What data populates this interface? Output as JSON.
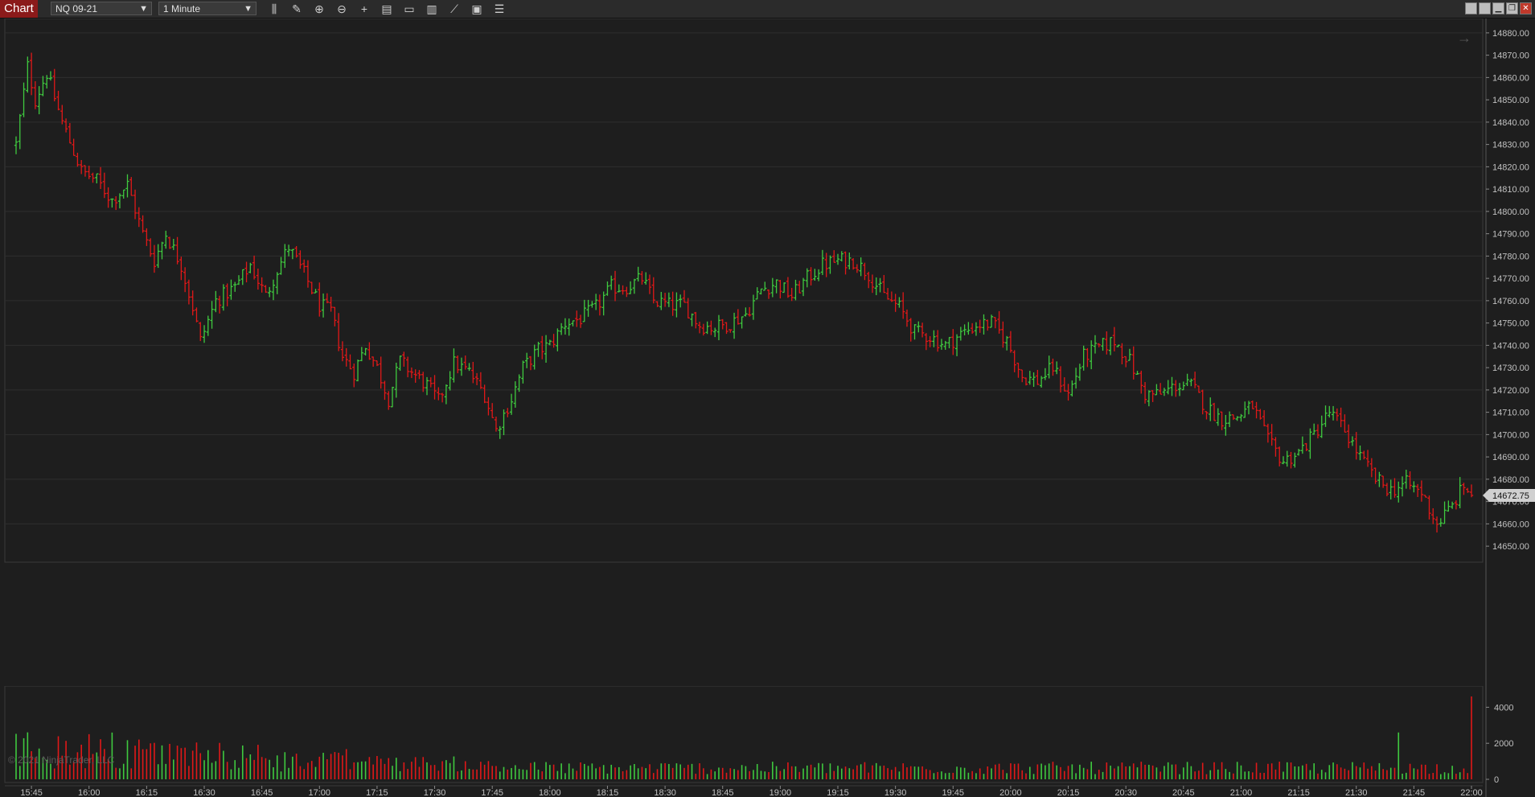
{
  "toolbar": {
    "tab_label": "Chart",
    "instrument": "NQ 09-21",
    "interval": "1 Minute",
    "tools": [
      {
        "name": "bar-type-icon",
        "glyph": "⫼"
      },
      {
        "name": "drawing-pencil-icon",
        "glyph": "✎"
      },
      {
        "name": "zoom-in-icon",
        "glyph": "⊕"
      },
      {
        "name": "zoom-out-icon",
        "glyph": "⊖"
      },
      {
        "name": "crosshair-icon",
        "glyph": "+"
      },
      {
        "name": "data-series-icon",
        "glyph": "▤"
      },
      {
        "name": "templates-icon",
        "glyph": "▭"
      },
      {
        "name": "indicators-icon",
        "glyph": "▥"
      },
      {
        "name": "strategies-icon",
        "glyph": "⟋"
      },
      {
        "name": "chart-trader-icon",
        "glyph": "▣"
      },
      {
        "name": "properties-list-icon",
        "glyph": "☰"
      }
    ],
    "window_buttons": [
      {
        "name": "window-tile-icon",
        "glyph": ""
      },
      {
        "name": "window-tile2-icon",
        "glyph": ""
      },
      {
        "name": "minimize-icon",
        "glyph": "▁"
      },
      {
        "name": "restore-icon",
        "glyph": "❐"
      },
      {
        "name": "close-icon",
        "glyph": "✕"
      }
    ]
  },
  "colors": {
    "background": "#1e1e1e",
    "grid": "#2e2e2e",
    "up": "#3fc93f",
    "down": "#e01818",
    "axis_text": "#c0c0c0",
    "price_marker_bg": "#d0d0d0"
  },
  "price_axis": {
    "min": 14645,
    "max": 14885,
    "labels": [
      "14880.00",
      "14870.00",
      "14860.00",
      "14850.00",
      "14840.00",
      "14830.00",
      "14820.00",
      "14810.00",
      "14800.00",
      "14790.00",
      "14780.00",
      "14770.00",
      "14760.00",
      "14750.00",
      "14740.00",
      "14730.00",
      "14720.00",
      "14710.00",
      "14700.00",
      "14690.00",
      "14680.00",
      "14670.00",
      "14660.00",
      "14650.00"
    ],
    "current_price": "14672.75"
  },
  "volume_axis": {
    "labels": [
      "4000",
      "2000",
      "0"
    ],
    "max": 5000
  },
  "time_axis": {
    "labels": [
      "15:45",
      "16:00",
      "16:15",
      "16:30",
      "16:45",
      "17:00",
      "17:15",
      "17:30",
      "17:45",
      "18:00",
      "18:15",
      "18:30",
      "18:45",
      "19:00",
      "19:15",
      "19:30",
      "19:45",
      "20:00",
      "20:15",
      "20:30",
      "20:45",
      "21:00",
      "21:15",
      "21:30",
      "21:45",
      "22:00"
    ]
  },
  "copyright": "© 2021 NinjaTrader, LLC",
  "chart_data": {
    "type": "ohlc",
    "bar_minutes": 1,
    "start_time": "15:41",
    "end_time": "22:00",
    "anchors": [
      [
        "15:41",
        14830
      ],
      [
        "15:44",
        14865
      ],
      [
        "15:46",
        14850
      ],
      [
        "15:49",
        14862
      ],
      [
        "15:53",
        14840
      ],
      [
        "15:58",
        14818
      ],
      [
        "16:02",
        14814
      ],
      [
        "16:06",
        14805
      ],
      [
        "16:10",
        14812
      ],
      [
        "16:14",
        14790
      ],
      [
        "16:17",
        14778
      ],
      [
        "16:20",
        14790
      ],
      [
        "16:24",
        14776
      ],
      [
        "16:27",
        14757
      ],
      [
        "16:29",
        14742
      ],
      [
        "16:33",
        14760
      ],
      [
        "16:38",
        14766
      ],
      [
        "16:42",
        14776
      ],
      [
        "16:46",
        14762
      ],
      [
        "16:49",
        14774
      ],
      [
        "16:52",
        14784
      ],
      [
        "16:56",
        14772
      ],
      [
        "17:00",
        14758
      ],
      [
        "17:03",
        14755
      ],
      [
        "17:06",
        14735
      ],
      [
        "17:09",
        14728
      ],
      [
        "17:12",
        14740
      ],
      [
        "17:15",
        14730
      ],
      [
        "17:18",
        14716
      ],
      [
        "17:21",
        14733
      ],
      [
        "17:24",
        14728
      ],
      [
        "17:28",
        14722
      ],
      [
        "17:31",
        14715
      ],
      [
        "17:35",
        14732
      ],
      [
        "17:39",
        14728
      ],
      [
        "17:43",
        14718
      ],
      [
        "17:46",
        14702
      ],
      [
        "17:50",
        14716
      ],
      [
        "17:53",
        14730
      ],
      [
        "17:57",
        14738
      ],
      [
        "18:00",
        14740
      ],
      [
        "18:04",
        14750
      ],
      [
        "18:08",
        14752
      ],
      [
        "18:12",
        14757
      ],
      [
        "18:16",
        14766
      ],
      [
        "18:20",
        14766
      ],
      [
        "18:24",
        14770
      ],
      [
        "18:27",
        14760
      ],
      [
        "18:31",
        14758
      ],
      [
        "18:35",
        14758
      ],
      [
        "18:39",
        14749
      ],
      [
        "18:43",
        14748
      ],
      [
        "18:47",
        14750
      ],
      [
        "18:51",
        14754
      ],
      [
        "18:55",
        14765
      ],
      [
        "18:59",
        14768
      ],
      [
        "19:03",
        14762
      ],
      [
        "19:07",
        14770
      ],
      [
        "19:11",
        14776
      ],
      [
        "19:15",
        14778
      ],
      [
        "19:19",
        14778
      ],
      [
        "19:23",
        14772
      ],
      [
        "19:27",
        14762
      ],
      [
        "19:31",
        14757
      ],
      [
        "19:35",
        14746
      ],
      [
        "19:39",
        14744
      ],
      [
        "19:43",
        14740
      ],
      [
        "19:47",
        14745
      ],
      [
        "19:51",
        14749
      ],
      [
        "19:55",
        14750
      ],
      [
        "19:59",
        14742
      ],
      [
        "20:03",
        14726
      ],
      [
        "20:07",
        14724
      ],
      [
        "20:11",
        14730
      ],
      [
        "20:15",
        14718
      ],
      [
        "20:19",
        14735
      ],
      [
        "20:23",
        14739
      ],
      [
        "20:27",
        14742
      ],
      [
        "20:31",
        14733
      ],
      [
        "20:35",
        14718
      ],
      [
        "20:39",
        14718
      ],
      [
        "20:43",
        14722
      ],
      [
        "20:47",
        14722
      ],
      [
        "20:51",
        14712
      ],
      [
        "20:55",
        14707
      ],
      [
        "20:59",
        14708
      ],
      [
        "21:03",
        14713
      ],
      [
        "21:07",
        14697
      ],
      [
        "21:11",
        14688
      ],
      [
        "21:15",
        14692
      ],
      [
        "21:19",
        14700
      ],
      [
        "21:23",
        14710
      ],
      [
        "21:27",
        14702
      ],
      [
        "21:31",
        14690
      ],
      [
        "21:35",
        14680
      ],
      [
        "21:39",
        14675
      ],
      [
        "21:43",
        14678
      ],
      [
        "21:47",
        14674
      ],
      [
        "21:51",
        14660
      ],
      [
        "21:55",
        14668
      ],
      [
        "21:58",
        14677
      ],
      [
        "22:00",
        14672.75
      ]
    ],
    "final_close": 14672.75,
    "volume_typical": 700,
    "volume_late_spike": 4600,
    "xlabel": "",
    "ylabel": ""
  }
}
